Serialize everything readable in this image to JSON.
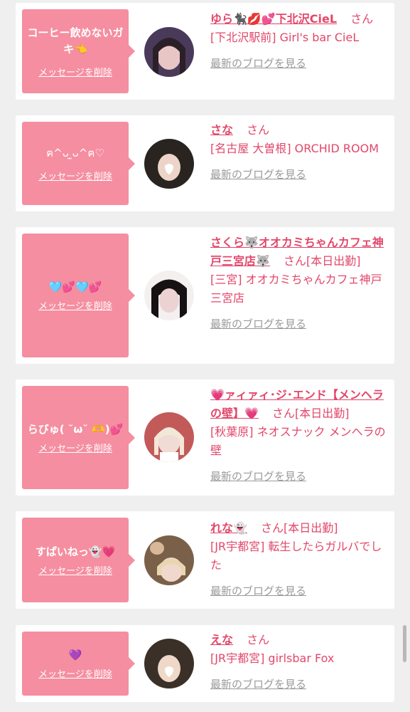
{
  "delete_label": "メッセージを削除",
  "blog_label": "最新のブログを見る",
  "san": "さん",
  "cards": [
    {
      "message": "コーヒー飲めないガキ👈",
      "name": "ゆら🐈‍⬛💋💕下北沢CieL",
      "status": "",
      "shop": "[下北沢駅前] Girl's bar CieL"
    },
    {
      "message": "ฅ^ᴗ ̫ᴗ^ฅ♡",
      "name": "さな",
      "status": "",
      "shop": "[名古屋 大曽根] ORCHID ROOM"
    },
    {
      "message": "🩵💕🩵💕",
      "name": "さくら🐺オオカミちゃんカフェ神戸三宮店🐺",
      "status": "[本日出勤]",
      "shop": "[三宮] オオカミちゃんカフェ神戸三宮店"
    },
    {
      "message": "らびゅ( ˘ω˘ 🫶)💕",
      "name": "💗ァィァィ･ジ･エンド【メンヘラの壁】💗",
      "status": "[本日出勤]",
      "shop": "[秋葉原] ネオスナック メンヘラの壁"
    },
    {
      "message": "すぱいねっ👻💗",
      "name": "れな👻",
      "status": "[本日出勤]",
      "shop": "[JR宇都宮] 転生したらガルバでした"
    },
    {
      "message": "💜",
      "name": "えな",
      "status": "",
      "shop": "[JR宇都宮] girlsbar Fox"
    }
  ]
}
